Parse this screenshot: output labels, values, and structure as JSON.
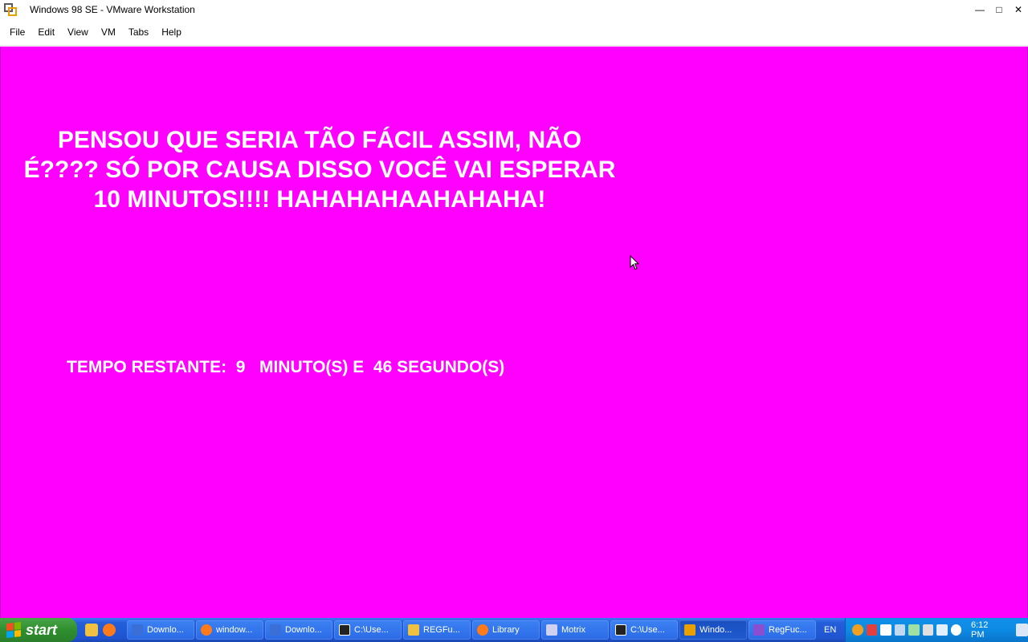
{
  "window": {
    "title": "Windows 98 SE - VMware Workstation",
    "controls": {
      "minimize": "—",
      "maximize": "□",
      "close": "✕"
    }
  },
  "menu": [
    "File",
    "Edit",
    "View",
    "VM",
    "Tabs",
    "Help"
  ],
  "vm": {
    "background_color": "#ff00ff",
    "message_lines": [
      "PENSOU QUE SERIA TÃO FÁCIL ASSIM, NÃO",
      "É???? SÓ POR CAUSA DISSO VOCÊ VAI ESPERAR",
      "10 MINUTOS!!!! HAHAHAHAAHAHAHA!"
    ],
    "timer_text": "TEMPO RESTANTE:  9   MINUTO(S) E  46 SEGUNDO(S)"
  },
  "taskbar": {
    "start_label": "start",
    "quick_launch": [
      {
        "icon": "folder-icon",
        "color": "#f0c040"
      },
      {
        "icon": "firefox-icon",
        "color": "#ff7a1a"
      }
    ],
    "tasks": [
      {
        "label": "Downlo...",
        "icon": "download-icon",
        "color": "#3a6fd8"
      },
      {
        "label": "window...",
        "icon": "firefox-icon",
        "color": "#ff7a1a"
      },
      {
        "label": "Downlo...",
        "icon": "download-icon",
        "color": "#3a6fd8"
      },
      {
        "label": "C:\\Use...",
        "icon": "7zip-icon",
        "color": "#222222"
      },
      {
        "label": "REGFu...",
        "icon": "folder-icon",
        "color": "#f0c040"
      },
      {
        "label": "Library",
        "icon": "firefox-icon",
        "color": "#ff7a1a"
      },
      {
        "label": "Motrix",
        "icon": "motrix-icon",
        "color": "#d0d0f0"
      },
      {
        "label": "C:\\Use...",
        "icon": "7zip-icon",
        "color": "#222222"
      },
      {
        "label": "Windo...",
        "icon": "vmware-icon",
        "color": "#e8a000",
        "active": true
      },
      {
        "label": "RegFuc...",
        "icon": "visual-studio-icon",
        "color": "#8a4fd0"
      }
    ],
    "language": "EN",
    "tray_icons": [
      {
        "icon": "search-icon",
        "color": "#f0a020"
      },
      {
        "icon": "security-icon",
        "color": "#e04040"
      },
      {
        "icon": "network-icon",
        "color": "#ffffff"
      },
      {
        "icon": "display-icon",
        "color": "#c0d8f0"
      },
      {
        "icon": "network-icon",
        "color": "#a0e0a0"
      },
      {
        "icon": "usb-icon",
        "color": "#e0e0e0"
      },
      {
        "icon": "monitor-icon",
        "color": "#e0f0ff"
      },
      {
        "icon": "volume-icon",
        "color": "#ffffff"
      }
    ],
    "clock": "6:12 PM"
  }
}
